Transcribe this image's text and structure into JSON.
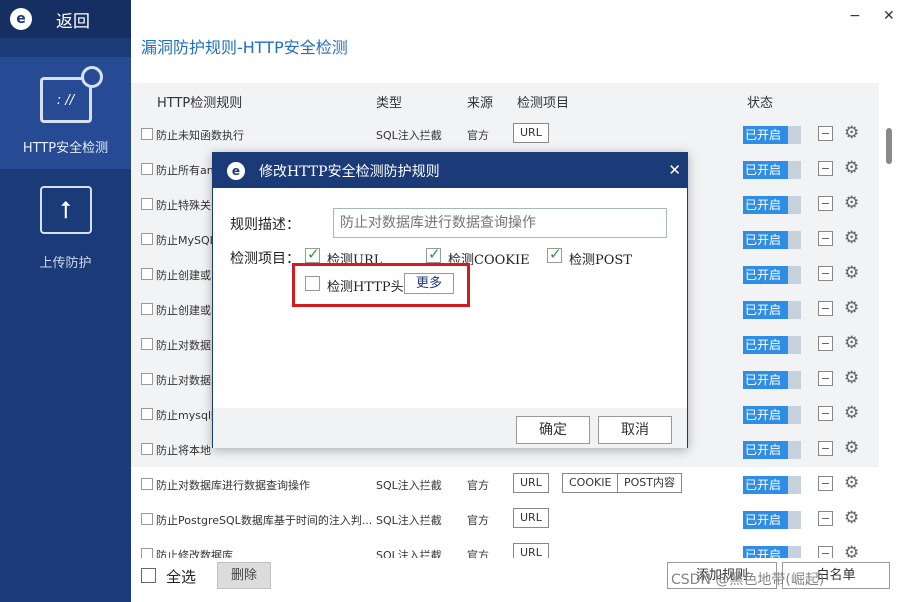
{
  "sidebar": {
    "back_label": "返回",
    "logo_letter": "e",
    "items": [
      {
        "label": "HTTP安全检测",
        "icon_text": ": //"
      },
      {
        "label": "上传防护",
        "icon_text": "⭡"
      }
    ]
  },
  "window": {
    "minimize": "−",
    "close": "✕"
  },
  "page_title": "漏洞防护规则-HTTP安全检测",
  "table": {
    "headers": {
      "rule": "HTTP检测规则",
      "type": "类型",
      "source": "来源",
      "items": "检测项目",
      "status": "状态"
    },
    "rows": [
      {
        "name": "防止未知函数执行",
        "type": "SQL注入拦截",
        "source": "官方",
        "tags": [
          "URL"
        ],
        "status": "已开启"
      },
      {
        "name": "防止所有an",
        "type": "",
        "source": "",
        "tags": [],
        "status": "已开启"
      },
      {
        "name": "防止特殊关",
        "type": "",
        "source": "",
        "tags": [],
        "status": "已开启"
      },
      {
        "name": "防止MySQL",
        "type": "",
        "source": "",
        "tags": [],
        "status": "已开启"
      },
      {
        "name": "防止创建或",
        "type": "",
        "source": "",
        "tags": [],
        "status": "已开启"
      },
      {
        "name": "防止创建或",
        "type": "",
        "source": "",
        "tags": [],
        "status": "已开启"
      },
      {
        "name": "防止对数据",
        "type": "",
        "source": "",
        "tags": [],
        "status": "已开启"
      },
      {
        "name": "防止对数据",
        "type": "",
        "source": "",
        "tags": [],
        "status": "已开启"
      },
      {
        "name": "防止mysql数",
        "type": "",
        "source": "",
        "tags": [],
        "status": "已开启"
      },
      {
        "name": "防止将本地",
        "type": "",
        "source": "",
        "tags": [],
        "status": "已开启"
      },
      {
        "name": "防止对数据库进行数据查询操作",
        "type": "SQL注入拦截",
        "source": "官方",
        "tags": [
          "URL",
          "COOKIE",
          "POST内容"
        ],
        "status": "已开启"
      },
      {
        "name": "防止PostgreSQL数据库基于时间的注入判...",
        "type": "SQL注入拦截",
        "source": "官方",
        "tags": [
          "URL"
        ],
        "status": "已开启"
      },
      {
        "name": "防止修改数据库",
        "type": "SQL注入拦截",
        "source": "官方",
        "tags": [
          "URL"
        ],
        "status": "已开启"
      }
    ]
  },
  "footer": {
    "select_all": "全选",
    "delete": "删除",
    "add_rule": "添加规则",
    "whitelist": "白名单",
    "watermark": "CSDN @黑色地带(崛起)"
  },
  "dialog": {
    "title": "修改HTTP安全检测防护规则",
    "close": "✕",
    "desc_label": "规则描述：",
    "desc_placeholder": "防止对数据库进行数据查询操作",
    "items_label": "检测项目：",
    "options": [
      {
        "label": "检测URL",
        "checked": true
      },
      {
        "label": "检测COOKIE",
        "checked": true
      },
      {
        "label": "检测POST",
        "checked": true
      },
      {
        "label": "检测HTTP头",
        "checked": false
      }
    ],
    "more": "更多",
    "ok": "确定",
    "cancel": "取消"
  },
  "colors": {
    "sidebar": "#1b3a78",
    "accent": "#1f6fbf",
    "status_on": "#2e8ee6",
    "highlight": "#d71920"
  }
}
